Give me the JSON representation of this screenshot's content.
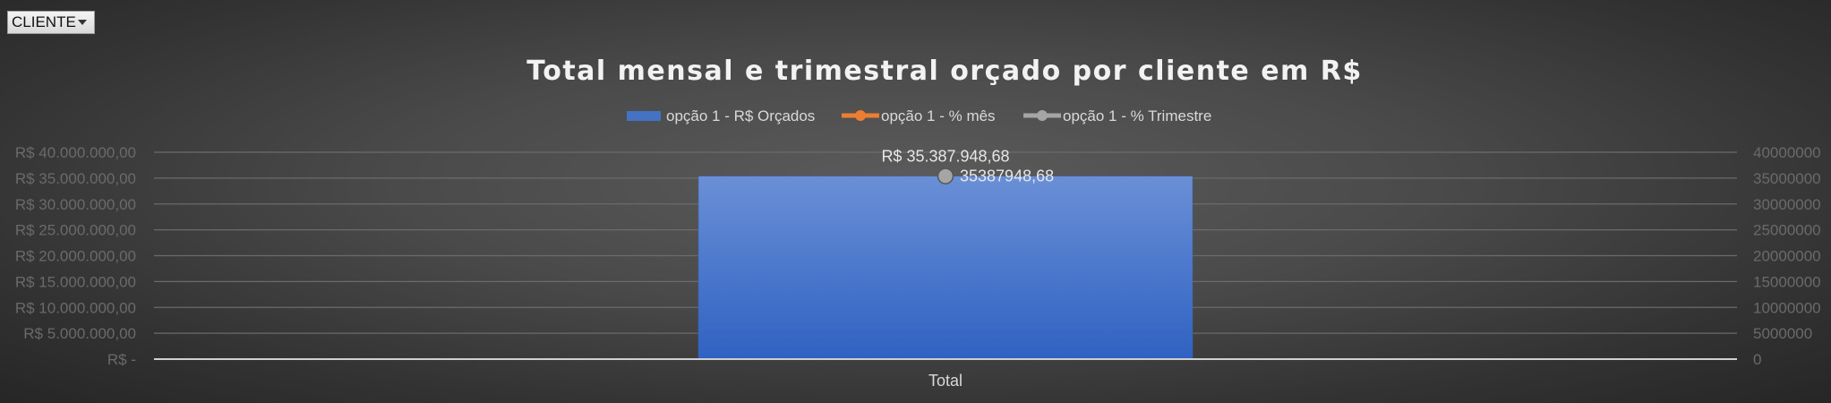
{
  "filter": {
    "label": "CLIENTE"
  },
  "chart_data": {
    "type": "bar",
    "title": "Total mensal e trimestral orçado por cliente em R$",
    "categories": [
      "Total"
    ],
    "series": [
      {
        "name": "opção 1 - R$ Orçados",
        "kind": "bar",
        "color": "#4472c4",
        "values": [
          35387948.68
        ]
      },
      {
        "name": "opção 1 - % mês",
        "kind": "line",
        "color": "#ed7d31",
        "values": [
          null
        ]
      },
      {
        "name": "opção 1 - % Trimestre",
        "kind": "line",
        "color": "#a5a5a5",
        "values": [
          35387948.68
        ]
      }
    ],
    "bar_data_label": "R$ 35.387.948,68",
    "point_data_label": "35387948,68",
    "ylim": [
      0,
      40000000
    ],
    "y_ticks_left": [
      "R$ -",
      "R$ 5.000.000,00",
      "R$ 10.000.000,00",
      "R$ 15.000.000,00",
      "R$ 20.000.000,00",
      "R$ 25.000.000,00",
      "R$ 30.000.000,00",
      "R$ 35.000.000,00",
      "R$ 40.000.000,00"
    ],
    "y_ticks_right": [
      "0",
      "5000000",
      "10000000",
      "15000000",
      "20000000",
      "25000000",
      "30000000",
      "35000000",
      "40000000"
    ],
    "grid": true,
    "legend_position": "top"
  }
}
